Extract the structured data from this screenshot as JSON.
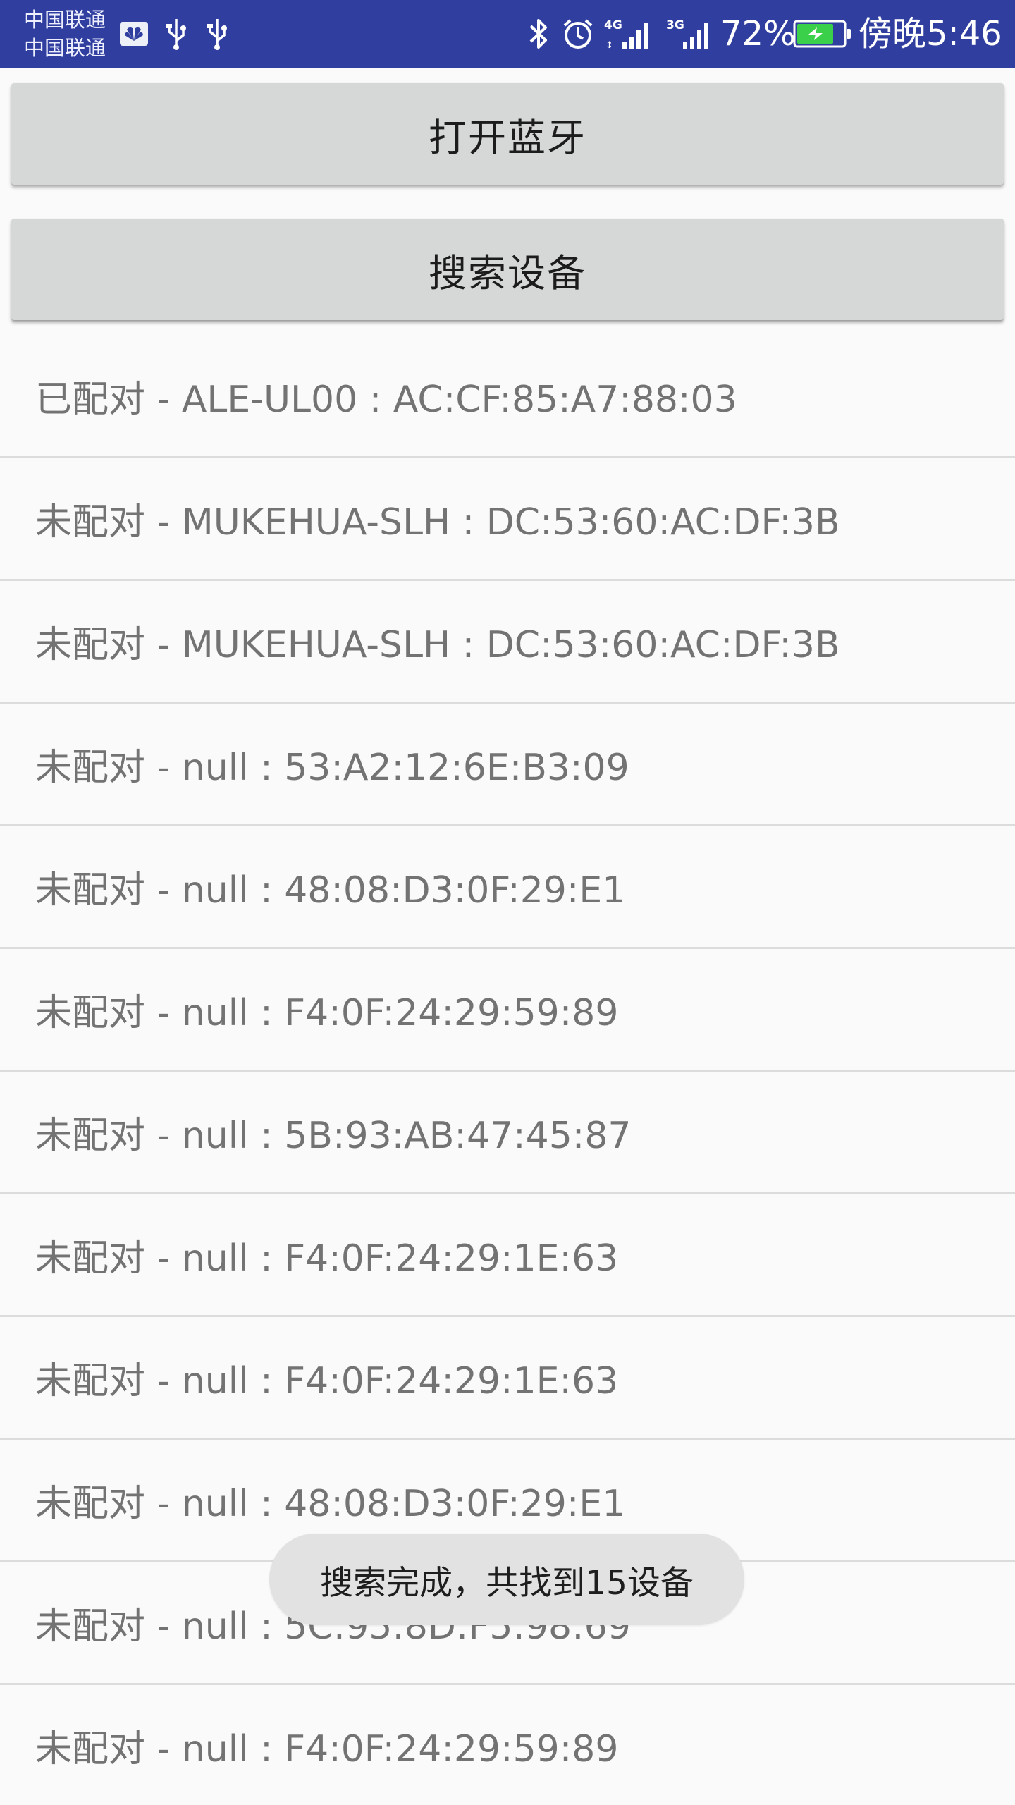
{
  "status_bar": {
    "carrier_1": "中国联通",
    "carrier_2": "中国联通",
    "left_icons": [
      "huawei-notification-icon",
      "usb-icon",
      "usb-icon"
    ],
    "right_icons": [
      "bluetooth-icon",
      "alarm-icon",
      "4g-signal-icon",
      "3g-signal-icon",
      "battery-charging-icon"
    ],
    "battery_percent": "72%",
    "time": "傍晚5:46",
    "background_color": "#303f9f"
  },
  "buttons": {
    "open_bluetooth": "打开蓝牙",
    "search_devices": "搜索设备"
  },
  "device_list": [
    "已配对 - ALE-UL00 : AC:CF:85:A7:88:03",
    "未配对 - MUKEHUA-SLH : DC:53:60:AC:DF:3B",
    "未配对 - MUKEHUA-SLH : DC:53:60:AC:DF:3B",
    "未配对 - null : 53:A2:12:6E:B3:09",
    "未配对 - null : 48:08:D3:0F:29:E1",
    "未配对 - null : F4:0F:24:29:59:89",
    "未配对 - null : 5B:93:AB:47:45:87",
    "未配对 - null : F4:0F:24:29:1E:63",
    "未配对 - null : F4:0F:24:29:1E:63",
    "未配对 - null : 48:08:D3:0F:29:E1",
    "未配对 - null : 5C:95:8D:F5:98:69",
    "未配对 - null : F4:0F:24:29:59:89"
  ],
  "toast": "搜索完成，共找到15设备"
}
